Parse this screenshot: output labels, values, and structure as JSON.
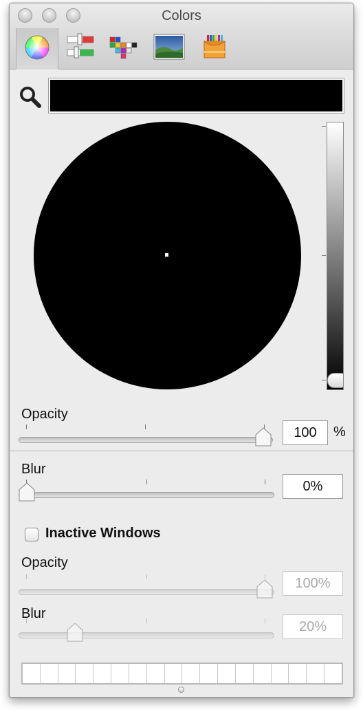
{
  "window": {
    "title": "Colors"
  },
  "toolbar": {
    "tabs": [
      {
        "name": "color-wheel",
        "selected": true
      },
      {
        "name": "color-sliders",
        "selected": false
      },
      {
        "name": "color-palettes",
        "selected": false
      },
      {
        "name": "image-palettes",
        "selected": false
      },
      {
        "name": "crayons",
        "selected": false
      }
    ]
  },
  "color": {
    "current_hex": "#000000",
    "brightness": 0.0
  },
  "active": {
    "opacity_label": "Opacity",
    "opacity_value": "100",
    "opacity_unit": "%",
    "opacity_level": 1.0,
    "blur_label": "Blur",
    "blur_value": "0%",
    "blur_level": 0.0
  },
  "inactive": {
    "checkbox_label": "Inactive Windows",
    "checked": false,
    "opacity_label": "Opacity",
    "opacity_value": "100%",
    "opacity_level": 1.0,
    "blur_label": "Blur",
    "blur_value": "20%",
    "blur_level": 0.2
  },
  "swatch_strip": {
    "count": 18,
    "colors": []
  }
}
